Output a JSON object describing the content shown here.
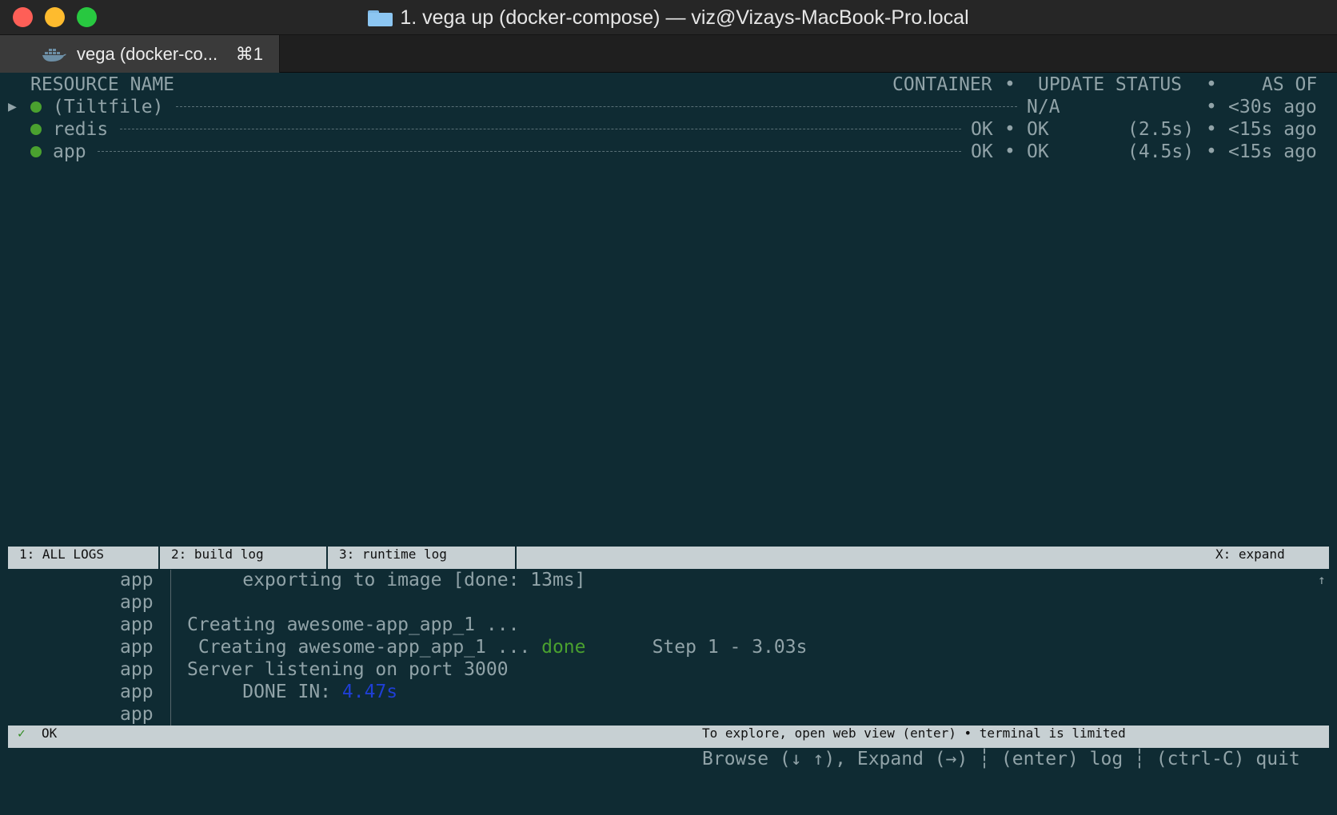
{
  "window": {
    "title": "1. vega up (docker-compose) — viz@Vizays-MacBook-Pro.local"
  },
  "tab": {
    "label": "vega (docker-co...",
    "shortcut": "⌘1"
  },
  "resources": {
    "headers": {
      "name": "RESOURCE NAME",
      "container": "CONTAINER",
      "update_status": "UPDATE STATUS",
      "as_of": "AS OF",
      "sep": "•"
    },
    "rows": [
      {
        "name": "(Tiltfile)",
        "container": "",
        "status": "N/A",
        "duration": "",
        "as_of": "<30s ago"
      },
      {
        "name": "redis",
        "container": "OK",
        "status": "OK",
        "duration": "(2.5s)",
        "as_of": "<15s ago"
      },
      {
        "name": "app",
        "container": "OK",
        "status": "OK",
        "duration": "(4.5s)",
        "as_of": "<15s ago"
      }
    ],
    "expand_glyph": "▶"
  },
  "log_tabs": {
    "all": "1: ALL LOGS",
    "build": "2: build log",
    "runtime": "3: runtime log",
    "expand": "X: expand"
  },
  "logs": [
    {
      "source": "app",
      "text": "     exporting to image [done: 13ms]"
    },
    {
      "source": "app",
      "text": ""
    },
    {
      "source": "app",
      "text": "Creating awesome-app_app_1 ..."
    },
    {
      "source": "app",
      "text": " Creating awesome-app_app_1 ... ",
      "highlight": "done",
      "suffix": "      Step 1 - 3.03s"
    },
    {
      "source": "app",
      "text": "Server listening on port 3000"
    },
    {
      "source": "app",
      "text": "     DONE IN: ",
      "highlight": "4.47s"
    },
    {
      "source": "app",
      "text": ""
    }
  ],
  "scroll_glyph": "↑",
  "status": {
    "check": "✓",
    "ok": "OK",
    "hint": "To explore, open web view (enter) • terminal is limited",
    "keys": "Browse (↓ ↑), Expand (→) ┆ (enter) log ┆ (ctrl-C) quit"
  },
  "colors": {
    "ok_dot": "#4aa12f",
    "done": "#4aa12f",
    "duration_highlight": "#1f3fd6",
    "background": "#0f2b33"
  }
}
